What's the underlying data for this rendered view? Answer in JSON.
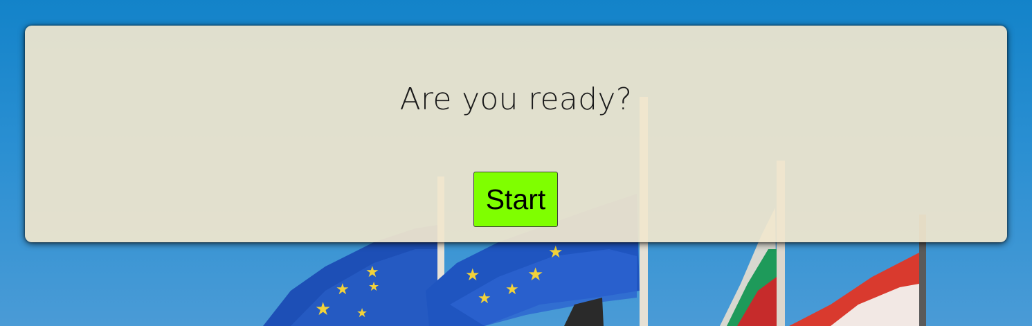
{
  "background": {
    "image": "eu-flags-photo",
    "sky_color": "#1a86cb"
  },
  "quiz": {
    "prompt": "Are you ready?",
    "start_label": "Start",
    "start_color": "#7fff00"
  }
}
